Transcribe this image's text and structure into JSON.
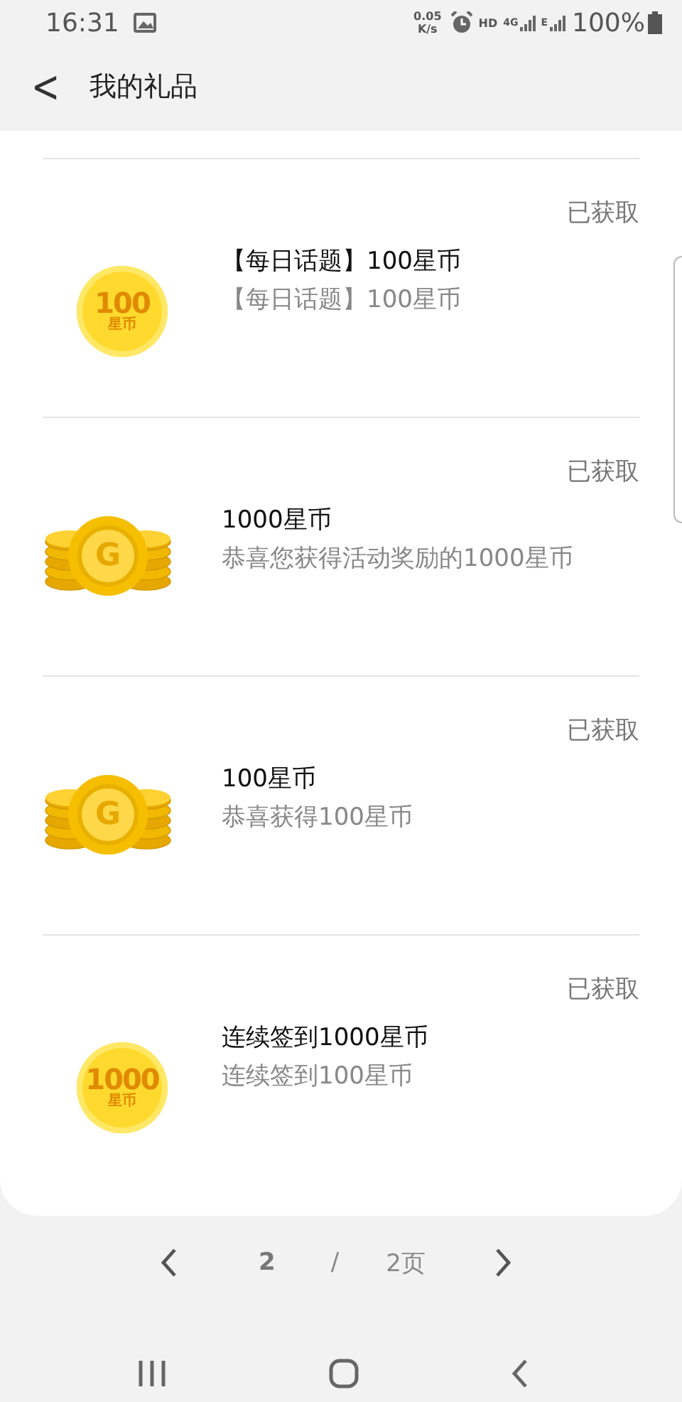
{
  "status_bar": {
    "time": "16:31",
    "net_speed": "0.05",
    "net_unit": "K/s",
    "hd": "HD",
    "network": "4G",
    "network_2": "E",
    "battery": "100%"
  },
  "header": {
    "back": "<",
    "title": "我的礼品"
  },
  "gifts": [
    {
      "kind": "badge",
      "badge_amount": "100",
      "badge_unit": "星币",
      "status": "已获取",
      "title": "【每日话题】100星币",
      "subtitle": "【每日话题】100星币"
    },
    {
      "kind": "stack",
      "coin_letter": "G",
      "status": "已获取",
      "title": "1000星币",
      "subtitle": "恭喜您获得活动奖励的1000星币"
    },
    {
      "kind": "stack",
      "coin_letter": "G",
      "status": "已获取",
      "title": "100星币",
      "subtitle": "恭喜获得100星币"
    },
    {
      "kind": "badge",
      "badge_amount": "1000",
      "badge_unit": "星币",
      "status": "已获取",
      "title": "连续签到1000星币",
      "subtitle": "连续签到100星币"
    }
  ],
  "pager": {
    "current": "2",
    "separator": "/",
    "total": "2页"
  }
}
